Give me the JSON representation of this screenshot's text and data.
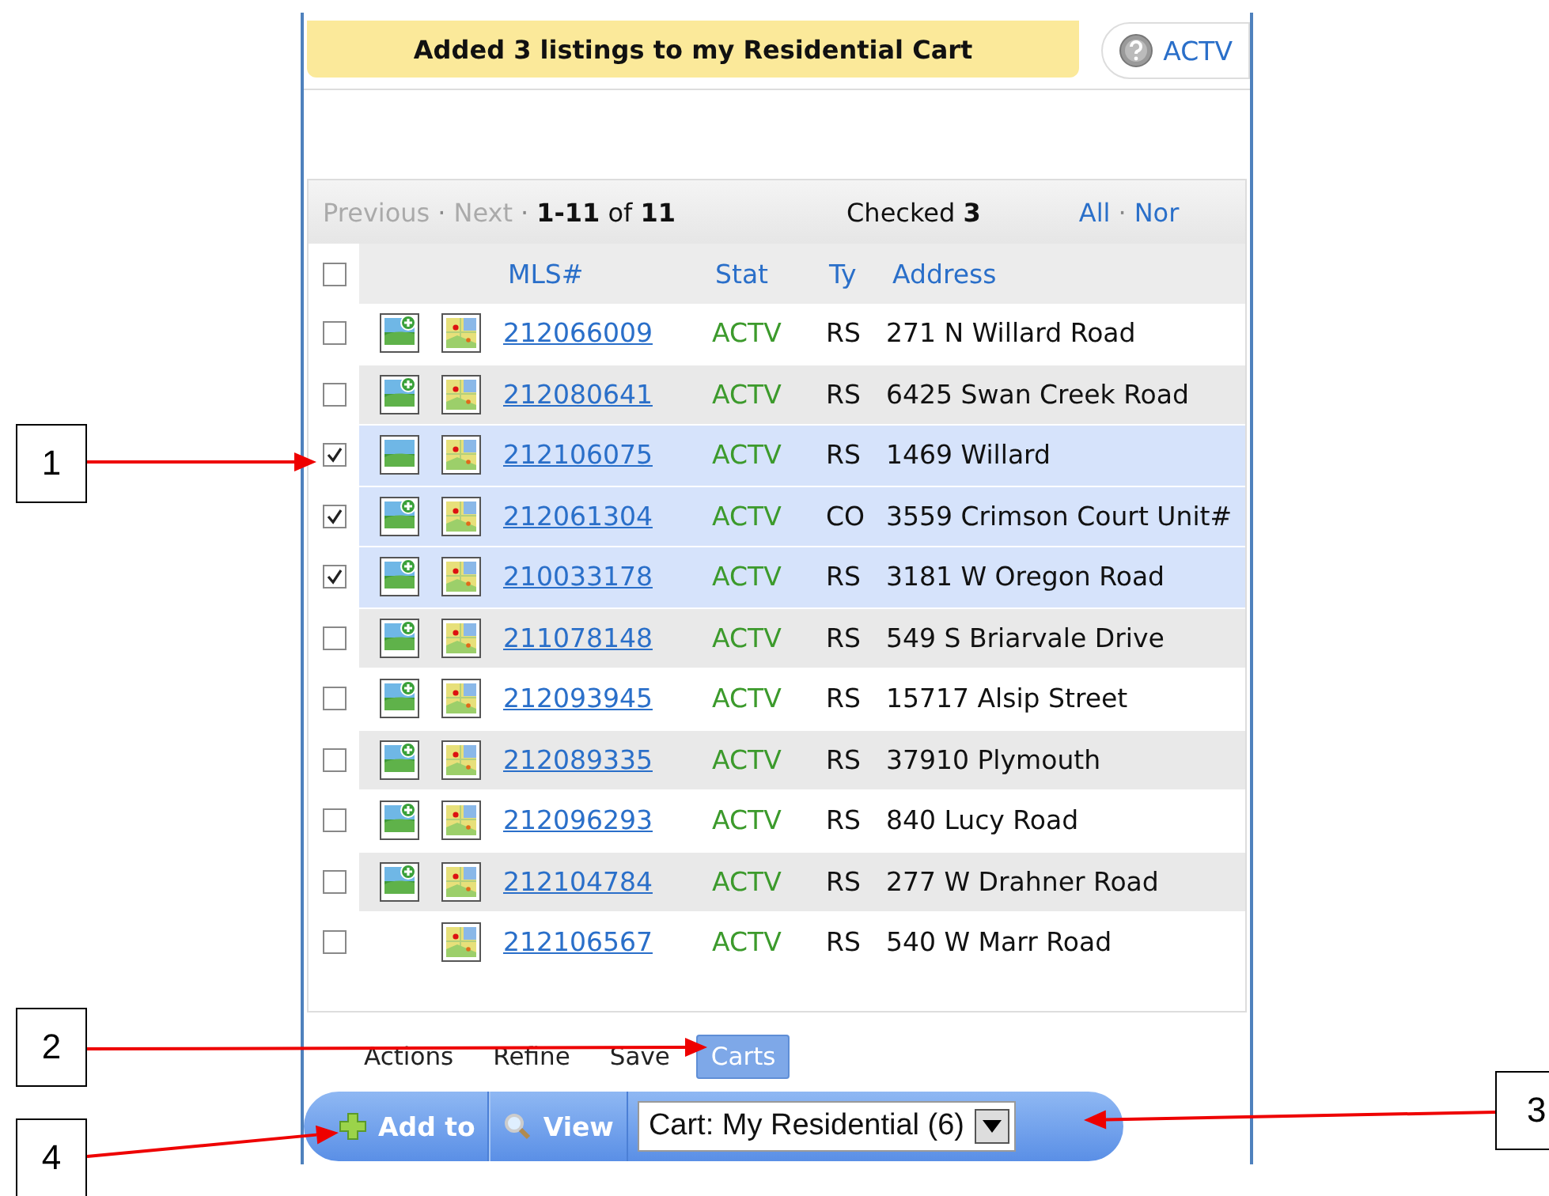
{
  "banner": {
    "message": "Added 3 listings to my Residential Cart"
  },
  "status_button": {
    "label": "ACTV"
  },
  "pager": {
    "previous": "Previous",
    "next": "Next",
    "separators": [
      "·",
      "·",
      "·"
    ],
    "range": "**1-11** of **11**",
    "checked": "Checked **3**",
    "select_all": "All",
    "select_none": "Nor"
  },
  "table": {
    "header_checked": false,
    "columns": [
      "MLS#",
      "Stat",
      "Ty",
      "Address"
    ],
    "rows": [
      {
        "kind": "photo-add",
        "checked": false,
        "mls": "212066009",
        "stat": "ACTV",
        "type": "RS",
        "address": "271 N Willard Road"
      },
      {
        "kind": "photo-add",
        "checked": false,
        "mls": "212080641",
        "stat": "ACTV",
        "type": "RS",
        "address": "6425 Swan Creek Road"
      },
      {
        "kind": "photo",
        "checked": true,
        "mls": "212106075",
        "stat": "ACTV",
        "type": "RS",
        "address": "1469 Willard"
      },
      {
        "kind": "photo-add",
        "checked": true,
        "mls": "212061304",
        "stat": "ACTV",
        "type": "CO",
        "address": "3559 Crimson Court Unit#"
      },
      {
        "kind": "photo-add",
        "checked": true,
        "mls": "210033178",
        "stat": "ACTV",
        "type": "RS",
        "address": "3181 W Oregon Road"
      },
      {
        "kind": "photo-add",
        "checked": false,
        "mls": "211078148",
        "stat": "ACTV",
        "type": "RS",
        "address": "549 S Briarvale Drive"
      },
      {
        "kind": "photo-add",
        "checked": false,
        "mls": "212093945",
        "stat": "ACTV",
        "type": "RS",
        "address": "15717 Alsip Street"
      },
      {
        "kind": "photo-add",
        "checked": false,
        "mls": "212089335",
        "stat": "ACTV",
        "type": "RS",
        "address": "37910 Plymouth"
      },
      {
        "kind": "photo-add",
        "checked": false,
        "mls": "212096293",
        "stat": "ACTV",
        "type": "RS",
        "address": "840 Lucy Road"
      },
      {
        "kind": "photo-add",
        "checked": false,
        "mls": "212104784",
        "stat": "ACTV",
        "type": "RS",
        "address": "277 W Drahner Road"
      },
      {
        "kind": "no-photo",
        "checked": false,
        "mls": "212106567",
        "stat": "ACTV",
        "type": "RS",
        "address": "540 W Marr Road"
      }
    ]
  },
  "tabs": [
    {
      "label": "Actions",
      "selected": false
    },
    {
      "label": "Refine",
      "selected": false
    },
    {
      "label": "Save",
      "selected": false
    },
    {
      "label": "Carts",
      "selected": true
    }
  ],
  "cart_bar": {
    "add_button": "Add to",
    "view_button": "View",
    "cart_select": "Cart: My Residential (6)"
  },
  "callouts": [
    {
      "label": "1"
    },
    {
      "label": "2"
    },
    {
      "label": "3"
    },
    {
      "label": "4"
    }
  ]
}
